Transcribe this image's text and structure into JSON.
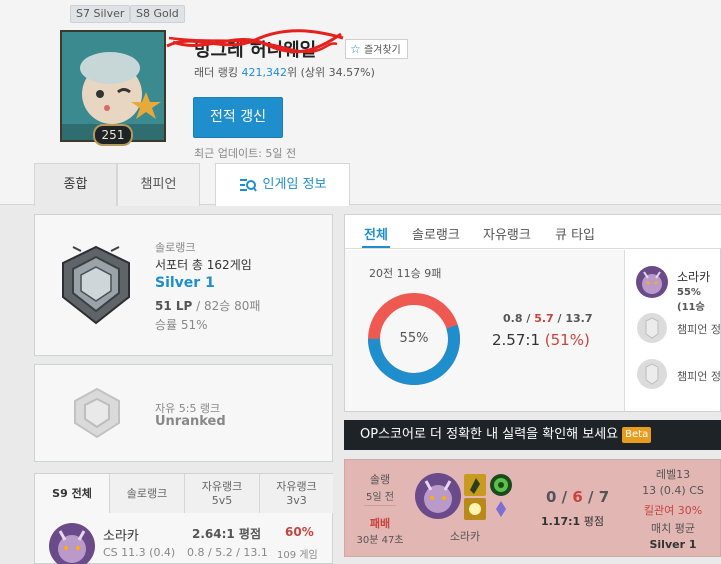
{
  "header": {
    "badges": [
      "S7 Silver",
      "S8 Gold"
    ],
    "level": "251",
    "summoner_name": "빙그레 허니웨일",
    "favorite_label": "즐겨찾기",
    "ladder_prefix": "래더 랭킹 ",
    "ladder_rank": "421,342",
    "ladder_suffix": "위 (상위 34.57%)",
    "update_button": "전적 갱신",
    "last_update": "최근 업데이트: 5일 전"
  },
  "tabs": {
    "overview": "종합",
    "champion": "챔피언",
    "ingame": "인게임 정보"
  },
  "solo_rank": {
    "title": "솔로랭크",
    "subtitle": "서포터 총 162게임",
    "tier": "Silver 1",
    "lp": "51 LP",
    "record": " / 82승 80패",
    "winrate": "승률 51%"
  },
  "flex_rank": {
    "title": "자유 5:5 랭크",
    "tier": "Unranked"
  },
  "stats": {
    "tabs": [
      "전체",
      "솔로랭크",
      "자유랭크",
      "큐 타입"
    ],
    "record": "20전 11승 9패",
    "winrate_label": "55%",
    "win_fraction": 0.55,
    "kda_k": "0.8",
    "kda_d": "5.7",
    "kda_a": "13.7",
    "kda_sep": " / ",
    "kda_ratio": "2.57:1",
    "kda_percent": "(51%)",
    "colors": {
      "win": "#1f8ecd",
      "loss": "#ee5a52"
    }
  },
  "recent_champs": {
    "first_name": "소라카",
    "first_stat": "55% (11승",
    "empty1": "챔피언 정",
    "empty2": "챔피언 정"
  },
  "banner": {
    "text": "OP스코어로 더 정확한 내 실력을 확인해 보세요",
    "beta": "Beta"
  },
  "match": {
    "queue": "솔랭",
    "when": "5일 전",
    "result": "패배",
    "duration": "30분 47초",
    "champion": "소라카",
    "k": "0",
    "d": "6",
    "a": "7",
    "sep": " / ",
    "kda": "1.17:1",
    "kda_label": " 평점",
    "level": "레벨13",
    "cs": "13 (0.4) CS",
    "kill_participation": "킬관여 30%",
    "avg_label": "매치 평균",
    "avg_tier": "Silver 1"
  },
  "season_tabs": {
    "all": "S9 전체",
    "solo": "솔로랭크",
    "flex5_line1": "자유랭크",
    "flex5_line2": "5v5",
    "flex3_line1": "자유랭크",
    "flex3_line2": "3v3"
  },
  "champ_list": {
    "name": "소라카",
    "cs": "CS 11.3 (0.4)",
    "kda": "2.64:1 평점",
    "kda_detail": "0.8 / 5.2 / 13.1",
    "winrate": "60%",
    "games": "109 게임"
  }
}
